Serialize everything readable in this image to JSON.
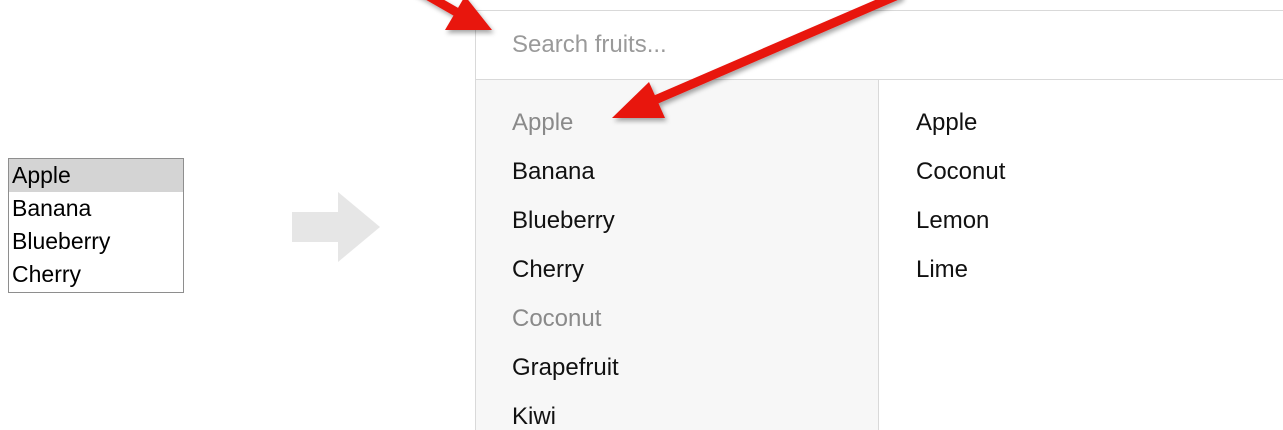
{
  "native_list": {
    "options": [
      {
        "label": "Apple",
        "selected": true
      },
      {
        "label": "Banana",
        "selected": false
      },
      {
        "label": "Blueberry",
        "selected": false
      },
      {
        "label": "Cherry",
        "selected": false
      }
    ]
  },
  "widget": {
    "search_placeholder": "Search fruits...",
    "search_value": "",
    "available_items": [
      {
        "label": "Apple",
        "already_selected": true
      },
      {
        "label": "Banana",
        "already_selected": false
      },
      {
        "label": "Blueberry",
        "already_selected": false
      },
      {
        "label": "Cherry",
        "already_selected": false
      },
      {
        "label": "Coconut",
        "already_selected": true
      },
      {
        "label": "Grapefruit",
        "already_selected": false
      },
      {
        "label": "Kiwi",
        "already_selected": false
      }
    ],
    "selected_items": [
      "Apple",
      "Coconut",
      "Lemon",
      "Lime"
    ]
  },
  "colors": {
    "annotation_arrow": "#e8130f",
    "transition_arrow": "#e6e6e6",
    "native_selected_bg": "#d4d4d4",
    "available_pane_bg": "#f7f7f7",
    "muted_item_text": "#8a8a8a",
    "divider": "#d9d9d9"
  },
  "icons": {
    "transition": "right-arrow-icon",
    "annotation": "red-pointer-arrow-icon"
  }
}
